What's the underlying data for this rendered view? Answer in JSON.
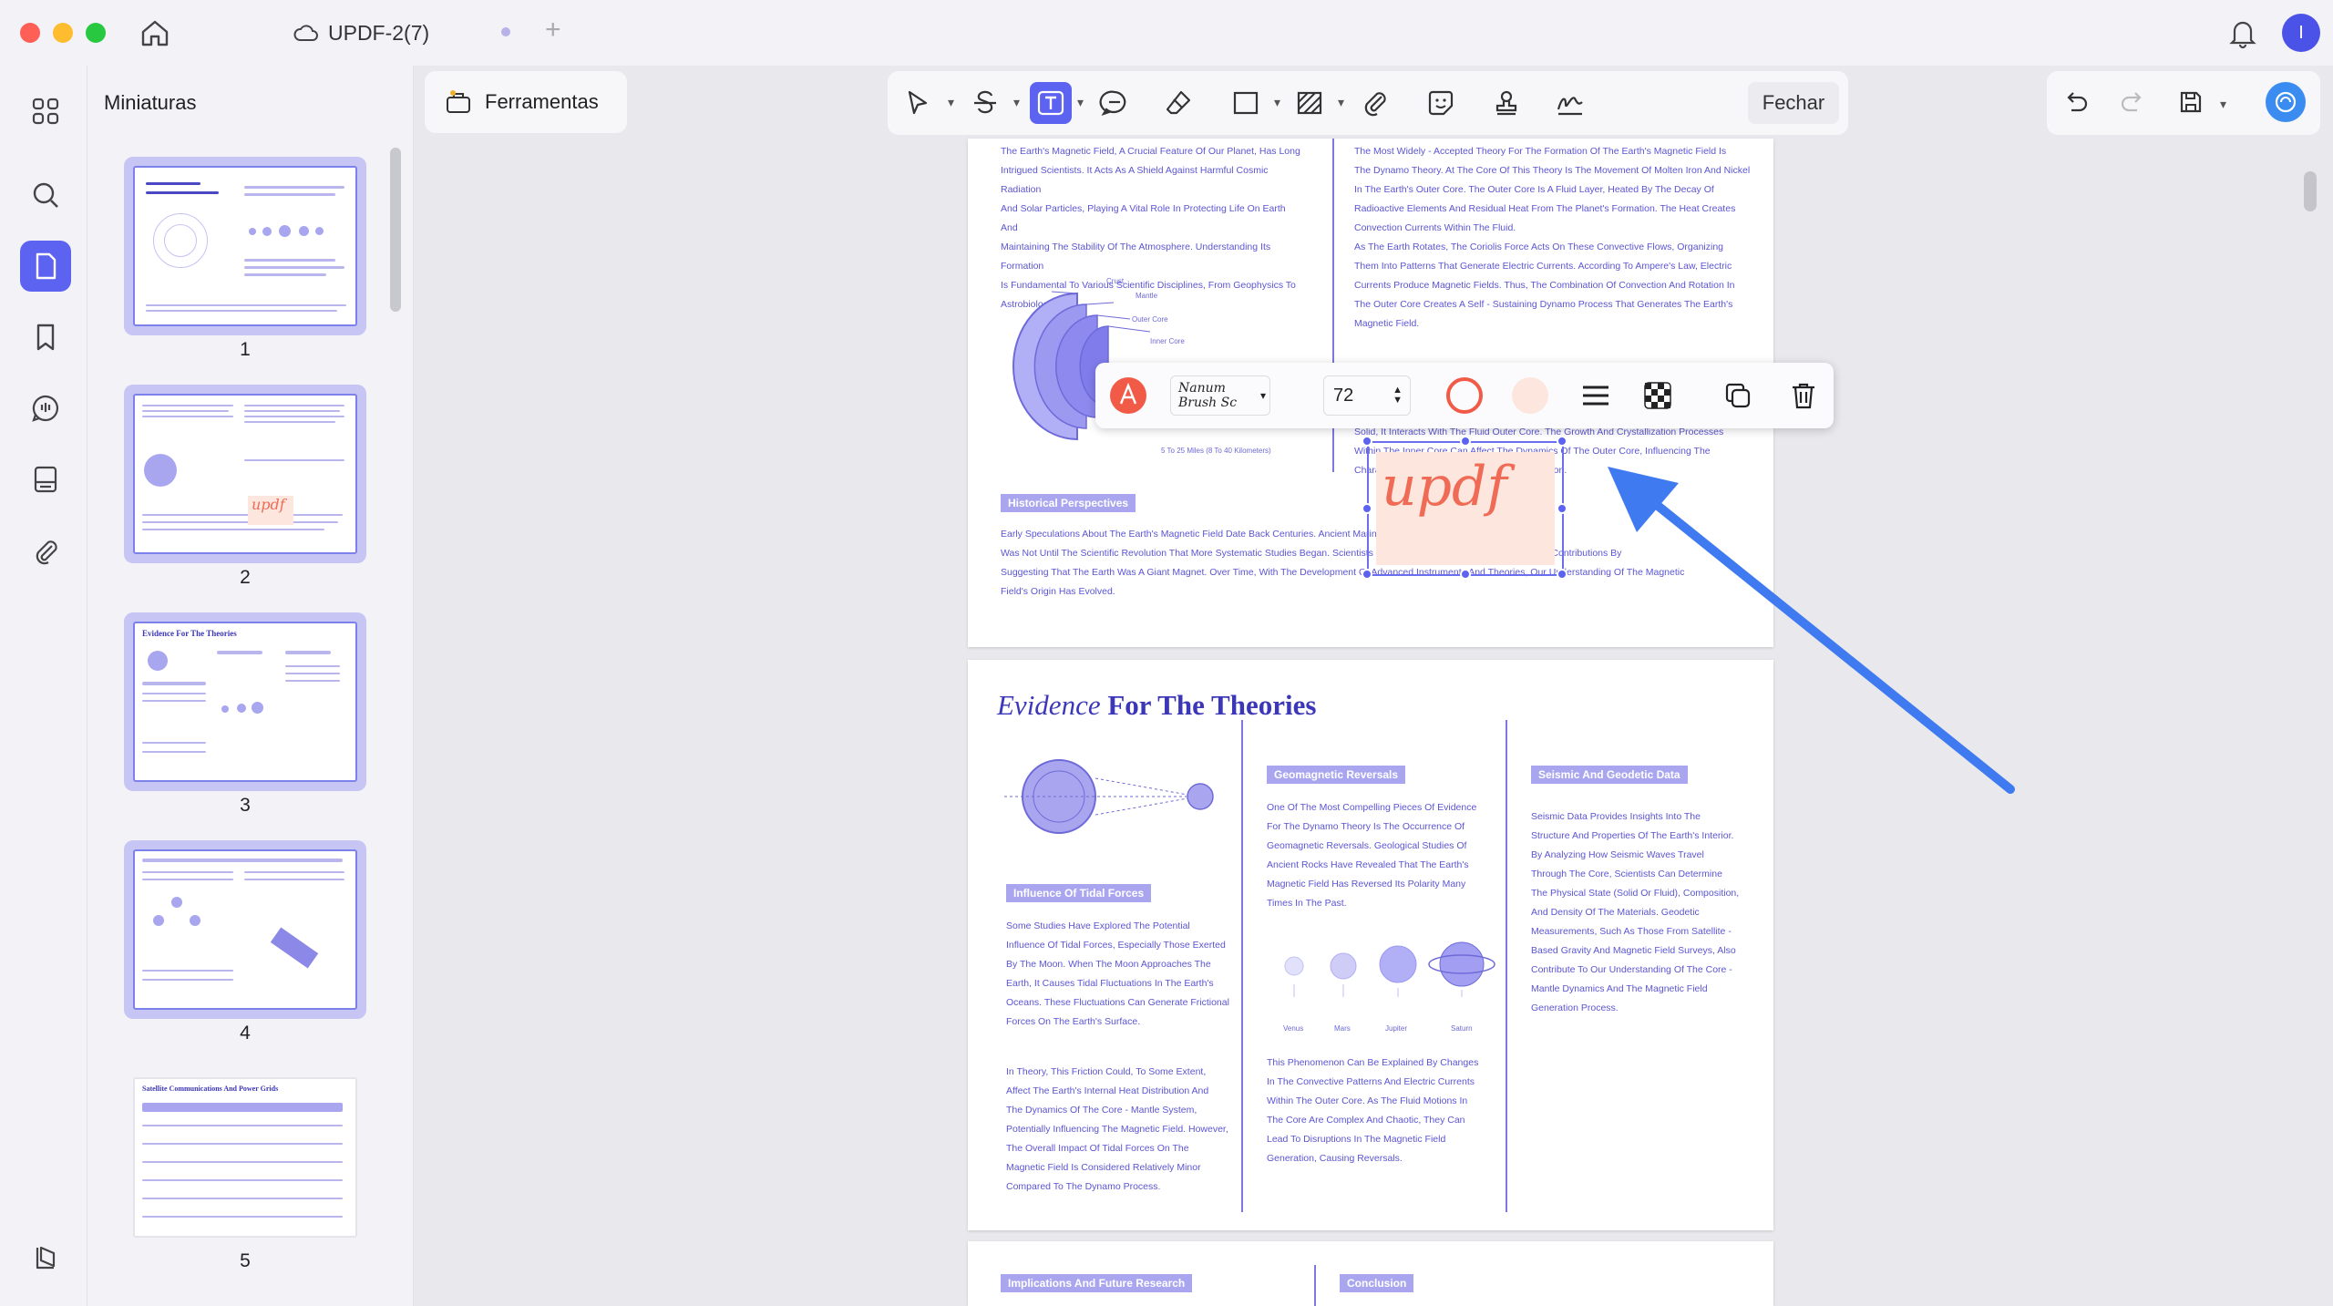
{
  "window": {
    "title": "UPDF-2(7)"
  },
  "user": {
    "avatar_initial": "I"
  },
  "sidebar": {
    "panel_title": "Miniaturas",
    "thumbnails": [
      {
        "number": "1"
      },
      {
        "number": "2",
        "stamp": "updf"
      },
      {
        "number": "3",
        "title": "Evidence For The Theories"
      },
      {
        "number": "4"
      },
      {
        "number": "5",
        "title": "Satellite Communications And Power Grids"
      }
    ]
  },
  "toolbar": {
    "tools_label": "Ferramentas",
    "close_label": "Fechar"
  },
  "format_bar": {
    "font": "Nanum Brush Sc",
    "size": "72",
    "colors": {
      "text": "#f05a46",
      "border": "#f05a46",
      "fill": "#fde6dd"
    }
  },
  "annotation": {
    "text": "updf"
  },
  "page_a": {
    "left_text": [
      "The Earth's Magnetic Field, A Crucial Feature Of Our Planet, Has Long",
      "Intrigued Scientists. It Acts As A Shield Against Harmful Cosmic Radiation",
      "And Solar Particles, Playing A Vital Role In Protecting Life On Earth And",
      "Maintaining The Stability Of The Atmosphere. Understanding Its Formation",
      "Is Fundamental To Various Scientific Disciplines, From Geophysics To",
      "Astrobiology."
    ],
    "diagram_labels": [
      "Crust",
      "Mantle",
      "Outer Core",
      "Inner Core"
    ],
    "diagram_caption": "5 To 25 Miles (8 To 40 Kilometers)",
    "right_text": [
      "The Most Widely - Accepted Theory For The Formation Of The Earth's Magnetic Field Is",
      "The Dynamo Theory. At The Core Of This Theory Is The Movement Of Molten Iron And Nickel",
      "In The Earth's Outer Core. The Outer Core Is A Fluid Layer, Heated By The Decay Of",
      "Radioactive Elements And Residual Heat From The Planet's Formation. The Heat Creates",
      "Convection Currents Within The Fluid.",
      "As The Earth Rotates, The Coriolis Force Acts On These Convective Flows, Organizing",
      "Them Into Patterns That Generate Electric Currents. According To Ampere's Law, Electric",
      "Currents Produce Magnetic Fields. Thus, The Combination Of Convection And Rotation In",
      "The Outer Core Creates A Self - Sustaining Dynamo Process That Generates The Earth's",
      "Magnetic Field."
    ],
    "right_text_2": [
      "Solid, It Interacts With The Fluid Outer Core. The Growth And Crystallization Processes",
      "Within The Inner Core Can Affect The Dynamics Of The Outer Core, Influencing The",
      "Characteristics Of The Magnetic Field Generation."
    ],
    "section_history": "Historical Perspectives",
    "history_text": [
      "Early Speculations About The Earth's Magnetic Field Date Back Centuries. Ancient Mariners Relied On Compass Needles, But It",
      "Was Not Until The Scientific Revolution That More Systematic Studies Began. Scientists Such As William Gilbert Made Significant Contributions By",
      "Suggesting That The Earth Was A Giant Magnet. Over Time, With The Development Of Advanced Instruments And Theories, Our Understanding Of The Magnetic",
      "Field's Origin Has Evolved."
    ]
  },
  "page_b": {
    "title_italic": "Evidence",
    "title_rest": "For The Theories",
    "section_tidal": "Influence Of Tidal Forces",
    "tidal_text": [
      "Some Studies Have Explored The Potential",
      "Influence Of Tidal Forces, Especially Those Exerted",
      "By The Moon. When The Moon Approaches The",
      "Earth, It Causes Tidal Fluctuations In The Earth's",
      "Oceans. These Fluctuations Can Generate Frictional",
      "Forces On The Earth's Surface."
    ],
    "tidal_text_2": [
      "In Theory, This Friction Could, To Some Extent,",
      "Affect The Earth's Internal Heat Distribution And",
      "The Dynamics Of The Core - Mantle System,",
      "Potentially Influencing The Magnetic Field. However,",
      "The Overall Impact Of Tidal Forces On The",
      "Magnetic Field Is Considered Relatively Minor",
      "Compared To The Dynamo Process."
    ],
    "section_geo": "Geomagnetic Reversals",
    "geo_text": [
      "One Of The Most Compelling Pieces Of Evidence",
      "For The Dynamo Theory Is The Occurrence Of",
      "Geomagnetic Reversals. Geological Studies Of",
      "Ancient Rocks Have Revealed That The Earth's",
      "Magnetic Field Has Reversed Its Polarity Many",
      "Times In The Past."
    ],
    "planets": [
      "Venus",
      "Mars",
      "Jupiter",
      "Saturn"
    ],
    "geo_text_2": [
      "This Phenomenon Can Be Explained By Changes",
      "In The Convective Patterns And Electric Currents",
      "Within The Outer Core. As The Fluid Motions In",
      "The Core Are Complex And Chaotic, They Can",
      "Lead To Disruptions In The Magnetic Field",
      "Generation, Causing Reversals."
    ],
    "section_seismic": "Seismic And Geodetic Data",
    "seismic_text": [
      "Seismic Data Provides Insights Into The",
      "Structure And Properties Of The Earth's Interior.",
      "By Analyzing How Seismic Waves Travel",
      "Through The Core, Scientists Can Determine",
      "The Physical State (Solid Or Fluid), Composition,",
      "And Density Of The Materials. Geodetic",
      "Measurements, Such As Those From Satellite -",
      "Based Gravity And Magnetic Field Surveys, Also",
      "Contribute To Our Understanding Of The Core -",
      "Mantle Dynamics And The Magnetic Field",
      "Generation Process."
    ]
  },
  "page_c": {
    "section_impl": "Implications And Future Research",
    "section_concl": "Conclusion"
  }
}
